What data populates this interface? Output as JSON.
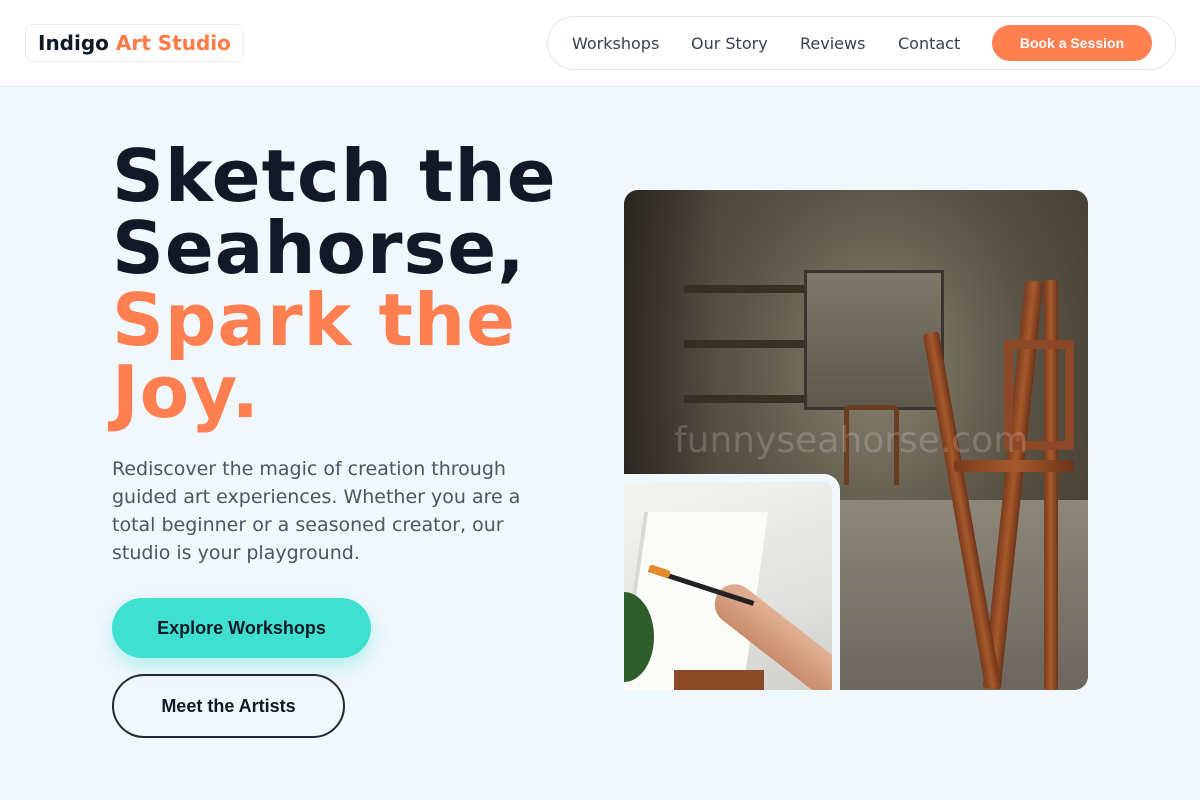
{
  "header": {
    "logo_part1": "Indigo",
    "logo_part2": "Art Studio",
    "nav": [
      "Workshops",
      "Our Story",
      "Reviews",
      "Contact"
    ],
    "cta_label": "Book a Session"
  },
  "hero": {
    "headline_dark_line1": "Sketch the",
    "headline_dark_line2": "Seahorse,",
    "headline_accent_line1": "Spark the",
    "headline_accent_line2": "Joy.",
    "subtitle": "Rediscover the magic of creation through guided art experiences. Whether you are a total beginner or a seasoned creator, our studio is your playground.",
    "primary_button": "Explore Workshops",
    "secondary_button": "Meet the Artists"
  },
  "images": {
    "main_watermark": "funnyseahorse.com"
  },
  "colors": {
    "accent": "#ff7f50",
    "turquoise": "#40e0d0",
    "background": "#f0f7fd",
    "text_dark": "#111827"
  }
}
